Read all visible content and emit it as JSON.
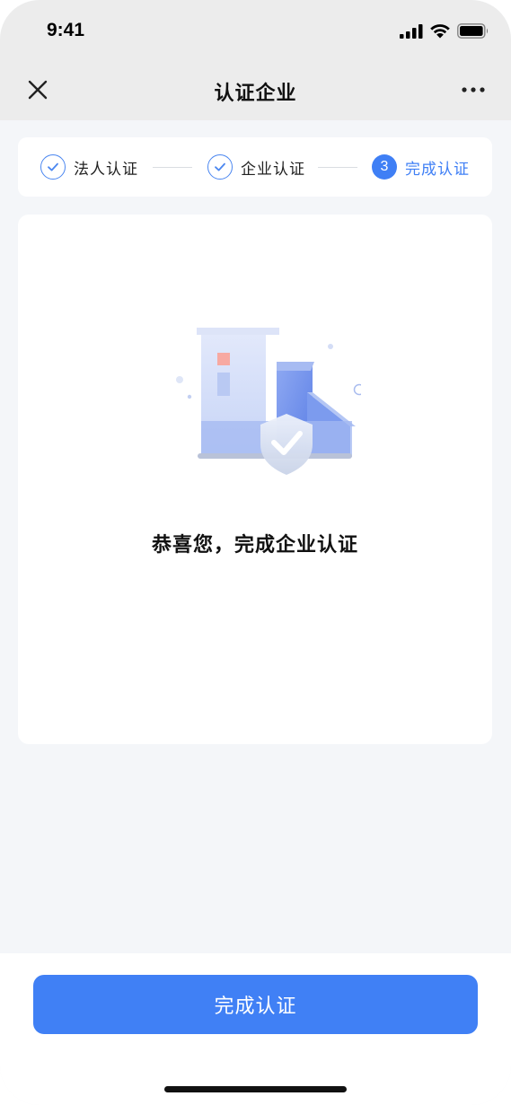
{
  "status_bar": {
    "time": "9:41"
  },
  "nav": {
    "title": "认证企业"
  },
  "stepper": {
    "steps": [
      {
        "label": "法人认证",
        "state": "done"
      },
      {
        "label": "企业认证",
        "state": "done"
      },
      {
        "label": "完成认证",
        "state": "current",
        "number": "3"
      }
    ]
  },
  "result": {
    "message": "恭喜您，完成企业认证"
  },
  "footer": {
    "button_label": "完成认证"
  },
  "colors": {
    "primary": "#4080f5",
    "header_bg": "#ececec",
    "page_bg": "#f4f6f9"
  }
}
